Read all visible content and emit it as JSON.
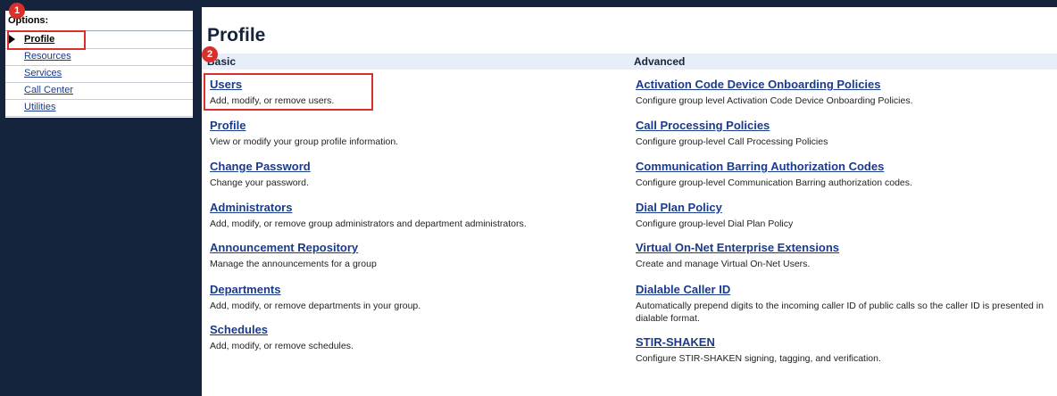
{
  "sidebar": {
    "title": "Options:",
    "items": [
      {
        "label": "Profile",
        "active": true
      },
      {
        "label": "Resources"
      },
      {
        "label": "Services"
      },
      {
        "label": "Call Center"
      },
      {
        "label": "Utilities"
      }
    ]
  },
  "markers": [
    "1",
    "2"
  ],
  "main": {
    "title": "Profile",
    "basic": {
      "header": "Basic",
      "entries": [
        {
          "title": "Users",
          "desc": "Add, modify, or remove users."
        },
        {
          "title": "Profile",
          "desc": "View or modify your group profile information."
        },
        {
          "title": "Change Password",
          "desc": "Change your password."
        },
        {
          "title": "Administrators",
          "desc": "Add, modify, or remove group administrators and department administrators."
        },
        {
          "title": "Announcement Repository",
          "desc": "Manage the announcements for a group"
        },
        {
          "title": "Departments",
          "desc": "Add, modify, or remove departments in your group."
        },
        {
          "title": "Schedules",
          "desc": "Add, modify, or remove schedules."
        }
      ]
    },
    "advanced": {
      "header": "Advanced",
      "entries": [
        {
          "title": "Activation Code Device Onboarding Policies",
          "desc": "Configure group level Activation Code Device Onboarding Policies."
        },
        {
          "title": "Call Processing Policies",
          "desc": "Configure group-level Call Processing Policies"
        },
        {
          "title": "Communication Barring Authorization Codes",
          "desc": "Configure group-level Communication Barring authorization codes."
        },
        {
          "title": "Dial Plan Policy",
          "desc": "Configure group-level Dial Plan Policy"
        },
        {
          "title": "Virtual On-Net Enterprise Extensions",
          "desc": "Create and manage Virtual On-Net Users."
        },
        {
          "title": "Dialable Caller ID",
          "desc": "Automatically prepend digits to the incoming caller ID of public calls so the caller ID is presented in dialable format."
        },
        {
          "title": "STIR-SHAKEN",
          "desc": "Configure STIR-SHAKEN signing, tagging, and verification."
        }
      ]
    }
  },
  "colors": {
    "accent": "#15233c",
    "link": "#1a3a8c",
    "highlight": "#d9302b"
  }
}
